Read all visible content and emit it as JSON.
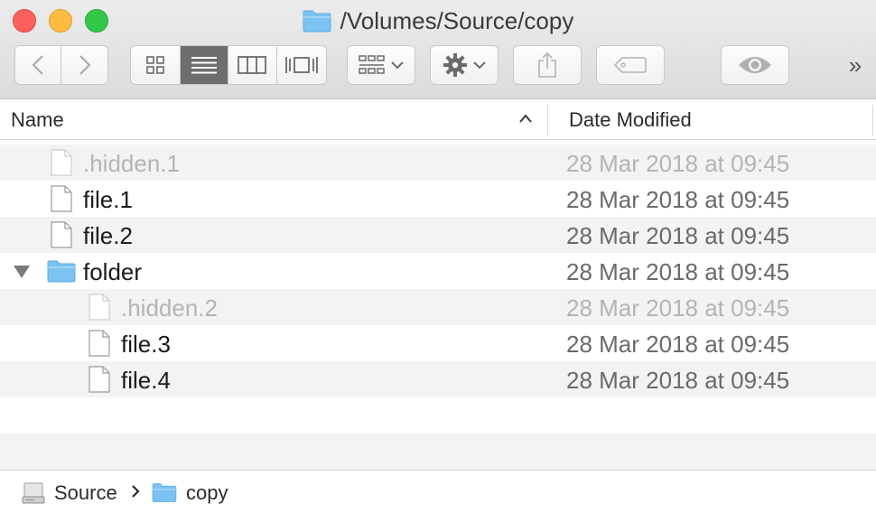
{
  "window": {
    "title": "/Volumes/Source/copy"
  },
  "toolbar": {
    "back_icon": "chevron-left-icon",
    "forward_icon": "chevron-right-icon",
    "view_modes": [
      "icon-view",
      "list-view",
      "column-view",
      "cover-flow-view"
    ],
    "active_view": "list-view",
    "more_label": "»"
  },
  "columns": {
    "name": "Name",
    "date": "Date Modified"
  },
  "files": [
    {
      "name": ".hidden.1",
      "date": "28 Mar 2018 at 09:45",
      "kind": "file",
      "hidden": true,
      "depth": 0
    },
    {
      "name": "file.1",
      "date": "28 Mar 2018 at 09:45",
      "kind": "file",
      "hidden": false,
      "depth": 0
    },
    {
      "name": "file.2",
      "date": "28 Mar 2018 at 09:45",
      "kind": "file",
      "hidden": false,
      "depth": 0
    },
    {
      "name": "folder",
      "date": "28 Mar 2018 at 09:45",
      "kind": "folder",
      "hidden": false,
      "depth": 0,
      "expanded": true
    },
    {
      "name": ".hidden.2",
      "date": "28 Mar 2018 at 09:45",
      "kind": "file",
      "hidden": true,
      "depth": 1
    },
    {
      "name": "file.3",
      "date": "28 Mar 2018 at 09:45",
      "kind": "file",
      "hidden": false,
      "depth": 1
    },
    {
      "name": "file.4",
      "date": "28 Mar 2018 at 09:45",
      "kind": "file",
      "hidden": false,
      "depth": 1
    }
  ],
  "pathbar": {
    "items": [
      {
        "label": "Source",
        "icon": "drive-icon"
      },
      {
        "label": "copy",
        "icon": "folder-icon"
      }
    ]
  },
  "colors": {
    "folder": "#7cc3f2",
    "active_segment": "#6e6e6e",
    "close": "#fc605c",
    "minimize": "#fdbc40",
    "zoom": "#34c84a"
  }
}
